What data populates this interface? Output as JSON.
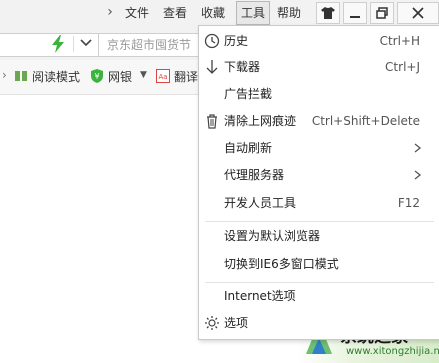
{
  "menubar": {
    "items": [
      "文件",
      "查看",
      "收藏",
      "工具",
      "帮助"
    ],
    "active_index": 3,
    "chevron": "chevron-right"
  },
  "window_controls": [
    "shirt-icon",
    "minimize-icon",
    "restore-icon",
    "close-icon"
  ],
  "address_bar": {
    "search_placeholder": "京东超市囤货节"
  },
  "bookmarks": [
    {
      "icon": "reading-mode-icon",
      "label": "阅读模式"
    },
    {
      "icon": "bank-shield-icon",
      "label": "网银"
    },
    {
      "icon": "translate-icon",
      "label": "翻译"
    }
  ],
  "tools_menu": {
    "items": [
      {
        "label": "历史",
        "shortcut": "Ctrl+H",
        "icon": "history-clock-icon"
      },
      {
        "label": "下载器",
        "shortcut": "Ctrl+J",
        "icon": "download-arrow-icon"
      },
      {
        "label": "广告拦截",
        "shortcut": ""
      },
      {
        "label": "清除上网痕迹",
        "shortcut": "Ctrl+Shift+Delete",
        "icon": "trash-icon"
      },
      {
        "label": "自动刷新",
        "submenu": true
      },
      {
        "label": "代理服务器",
        "submenu": true
      },
      {
        "label": "开发人员工具",
        "shortcut": "F12"
      },
      {
        "label": "设置为默认浏览器"
      },
      {
        "label": "切换到IE6多窗口模式"
      },
      {
        "label": "Internet选项"
      },
      {
        "label": "选项",
        "icon": "gear-icon"
      }
    ]
  },
  "watermark": {
    "text": "系统之家",
    "url": "www.xitongzhijia.net"
  },
  "colors": {
    "bolt_green": "#3cb33c",
    "menubar_bg": "#f2f2f2"
  }
}
